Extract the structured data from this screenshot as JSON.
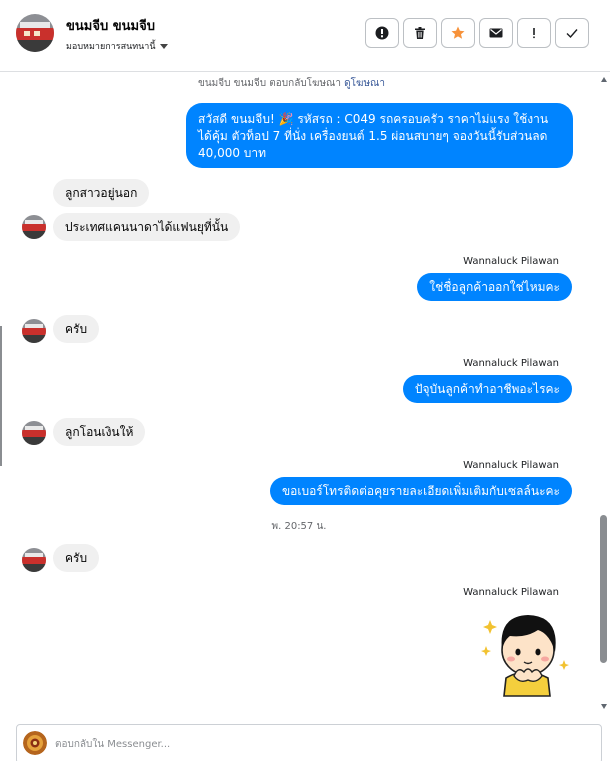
{
  "header": {
    "contact_name": "ขนมจีบ ขนมจีบ",
    "assign_label": "มอบหมายการสนทนานี้",
    "actions": [
      "flag-icon",
      "trash-icon",
      "star-icon",
      "envelope-icon",
      "exclamation-icon",
      "check-icon"
    ]
  },
  "thread": {
    "ad_reply_prefix": "ขนมจีบ ขนมจีบ ตอบกลับโฆษณา",
    "ad_link": "ดูโฆษณา",
    "messages": [
      {
        "direction": "outgoing",
        "text": "สวัสดี ขนมจีบ! 🎉 รหัสรถ : C049 รถครอบครัว ราคาไม่แรง ใช้งานได้คุ้ม ตัวท็อป 7 ที่นั่ง เครื่องยนต์ 1.5 ผ่อนสบายๆ จองวันนี้รับส่วนลด 40,000 บาท"
      },
      {
        "direction": "incoming",
        "text": "ลูกสาวอยู่นอก"
      },
      {
        "direction": "incoming",
        "text": "ประเทศแคนนาดาได้แฟนยุที่นั้น"
      },
      {
        "direction": "outgoing",
        "sender": "Wannaluck Pilawan",
        "text": "ใช่ชื่อลูกค้าออกใช่ไหมคะ"
      },
      {
        "direction": "incoming",
        "text": "ครับ"
      },
      {
        "direction": "outgoing",
        "sender": "Wannaluck Pilawan",
        "text": "ปัจุบันลูกค้าทำอาชีพอะไรคะ"
      },
      {
        "direction": "incoming",
        "text": "ลูกโอนเงินให้"
      },
      {
        "direction": "outgoing",
        "sender": "Wannaluck Pilawan",
        "text": "ขอเบอร์โทรติดต่อคุยรายละเอียดเพิ่มเติมกับเซลล์นะคะ"
      },
      {
        "direction": "incoming",
        "text": "ครับ"
      },
      {
        "direction": "outgoing",
        "sender": "Wannaluck Pilawan",
        "sticker": "girl-sticker"
      }
    ],
    "timestamp": "พ. 20:57 น."
  },
  "composer": {
    "placeholder": "ตอบกลับใน Messenger..."
  },
  "colors": {
    "outgoing_bubble": "#0084ff",
    "incoming_bubble": "#f0f0f0",
    "ad_link": "#385898"
  }
}
